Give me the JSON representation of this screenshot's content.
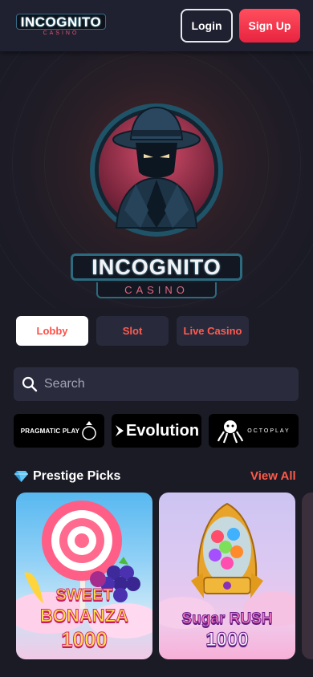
{
  "header": {
    "logo_text": "INCOGNITO",
    "logo_sub": "CASINO",
    "login_label": "Login",
    "signup_label": "Sign Up"
  },
  "hero": {
    "logo_text": "INCOGNITO",
    "logo_sub": "CASINO"
  },
  "tabs": [
    {
      "label": "Lobby",
      "active": true
    },
    {
      "label": "Slot",
      "active": false
    },
    {
      "label": "Live Casino",
      "active": false
    }
  ],
  "search": {
    "placeholder": "Search",
    "value": ""
  },
  "providers": [
    {
      "name": "PRAGMATIC PLAY"
    },
    {
      "name": "Evolution"
    },
    {
      "name": "OCTOPLAY"
    }
  ],
  "section": {
    "title": "Prestige Picks",
    "view_all": "View All",
    "icon": "diamond-icon"
  },
  "games": [
    {
      "line1": "SWEET",
      "line2": "BONANZA",
      "line3": "1000"
    },
    {
      "line1": "Sugar RUSH",
      "line2": "1000"
    }
  ],
  "colors": {
    "accent": "#ff4f47",
    "signup": "#ff3d50",
    "background": "#1b1b26",
    "header": "#1f2030",
    "tab_bg": "#282a3c"
  }
}
